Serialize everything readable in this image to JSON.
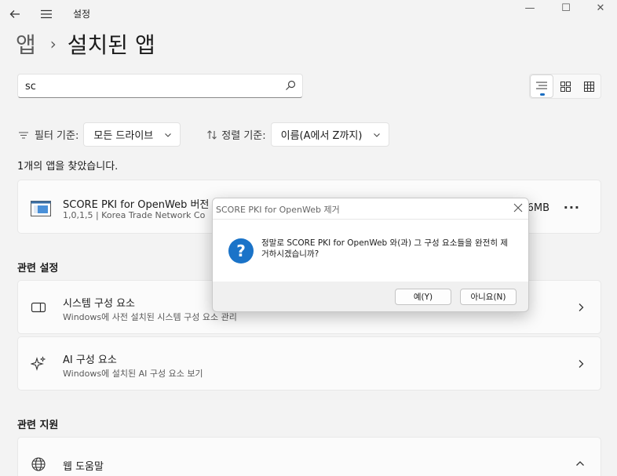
{
  "window": {
    "title": "설정",
    "minimize": "—",
    "maximize": "☐",
    "close": "✕"
  },
  "breadcrumb": {
    "parent": "앱",
    "separator": "›",
    "current": "설치된 앱"
  },
  "search": {
    "value": "sc",
    "placeholder": ""
  },
  "filter": {
    "label": "필터 기준:",
    "value": "모든 드라이브"
  },
  "sort": {
    "label": "정렬 기준:",
    "value": "이름(A에서 Z까지)"
  },
  "results": {
    "found_text": "1개의 앱을 찾았습니다."
  },
  "app": {
    "name": "SCORE PKI for OpenWeb 버전",
    "meta": "1,0,1,5  |  Korea Trade Network Co",
    "size": "6MB",
    "more": "···"
  },
  "related_settings": {
    "title": "관련 설정",
    "items": [
      {
        "title": "시스템 구성 요소",
        "desc": "Windows에 사전 설치된 시스템 구성 요소 관리",
        "icon": "system-component-icon"
      },
      {
        "title": "AI 구성 요소",
        "desc": "Windows에 설치된 AI 구성 요소 보기",
        "icon": "sparkle-icon"
      }
    ]
  },
  "related_support": {
    "title": "관련 지원",
    "items": [
      {
        "title": "웹 도움말",
        "icon": "globe-icon"
      }
    ]
  },
  "dialog": {
    "title": "SCORE PKI for OpenWeb 제거",
    "message": "정말로 SCORE PKI for OpenWeb 와(과) 그 구성 요소들을 완전히 제거하시겠습니까?",
    "yes_label": "예(Y)",
    "no_label": "아니요(N)",
    "icon": "question-icon"
  },
  "colors": {
    "accent": "#1b6ec2",
    "question_icon": "#1a73c8",
    "background": "#f3f3f3"
  }
}
